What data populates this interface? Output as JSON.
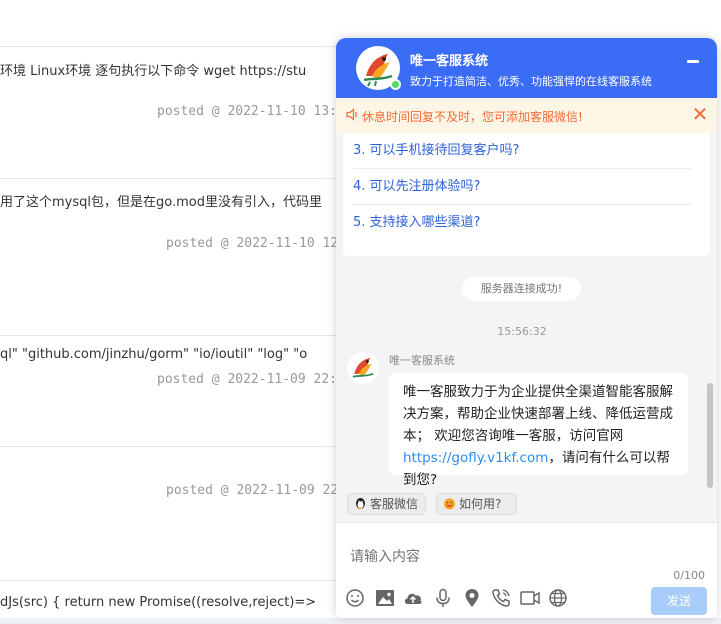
{
  "background": {
    "rows": [
      {
        "text": "环境 Linux环境 逐句执行以下命令 wget https://stu",
        "meta": "posted @ 2022-11-10 13:2"
      },
      {
        "text": "用了这个mysql包，但是在go.mod里没有引入，代码里",
        "meta": "posted @ 2022-11-10 12"
      },
      {
        "text": "ql\" \"github.com/jinzhu/gorm\" \"io/ioutil\" \"log\" \"o",
        "meta": "posted @ 2022-11-09 22:2"
      },
      {
        "text": "",
        "meta": "posted @ 2022-11-09 22"
      },
      {
        "text": "dJs(src) { return new Promise((resolve,reject)=>",
        "meta": ""
      }
    ]
  },
  "chat": {
    "title": "唯一客服系统",
    "subtitle": "致力于打造简洁、优秀、功能强悍的在线客服系统",
    "notice": "休息时间回复不及时，您可添加客服微信!",
    "faq": [
      "3. 可以手机接待回复客户吗?",
      "4. 可以先注册体验吗?",
      "5. 支持接入哪些渠道?"
    ],
    "system_message": "服务器连接成功!",
    "timestamp": "15:56:32",
    "bot_name": "唯一客服系统",
    "message_before_link": "唯一客服致力于为企业提供全渠道智能客服解决方案，帮助企业快速部署上线、降低运营成本； 欢迎您咨询唯一客服，访问官网",
    "message_link": "https://gofly.v1kf.com",
    "message_after_link": "，请问有什么可以帮到您?",
    "quick_buttons": [
      "客服微信",
      "如何用?"
    ],
    "input_placeholder": "请输入内容",
    "counter": "0/100",
    "send_label": "发送",
    "colors": {
      "header": "#3b6cf6",
      "notice_text": "#f56c33",
      "link": "#2d8cf0",
      "send": "#a9cdf9"
    }
  }
}
